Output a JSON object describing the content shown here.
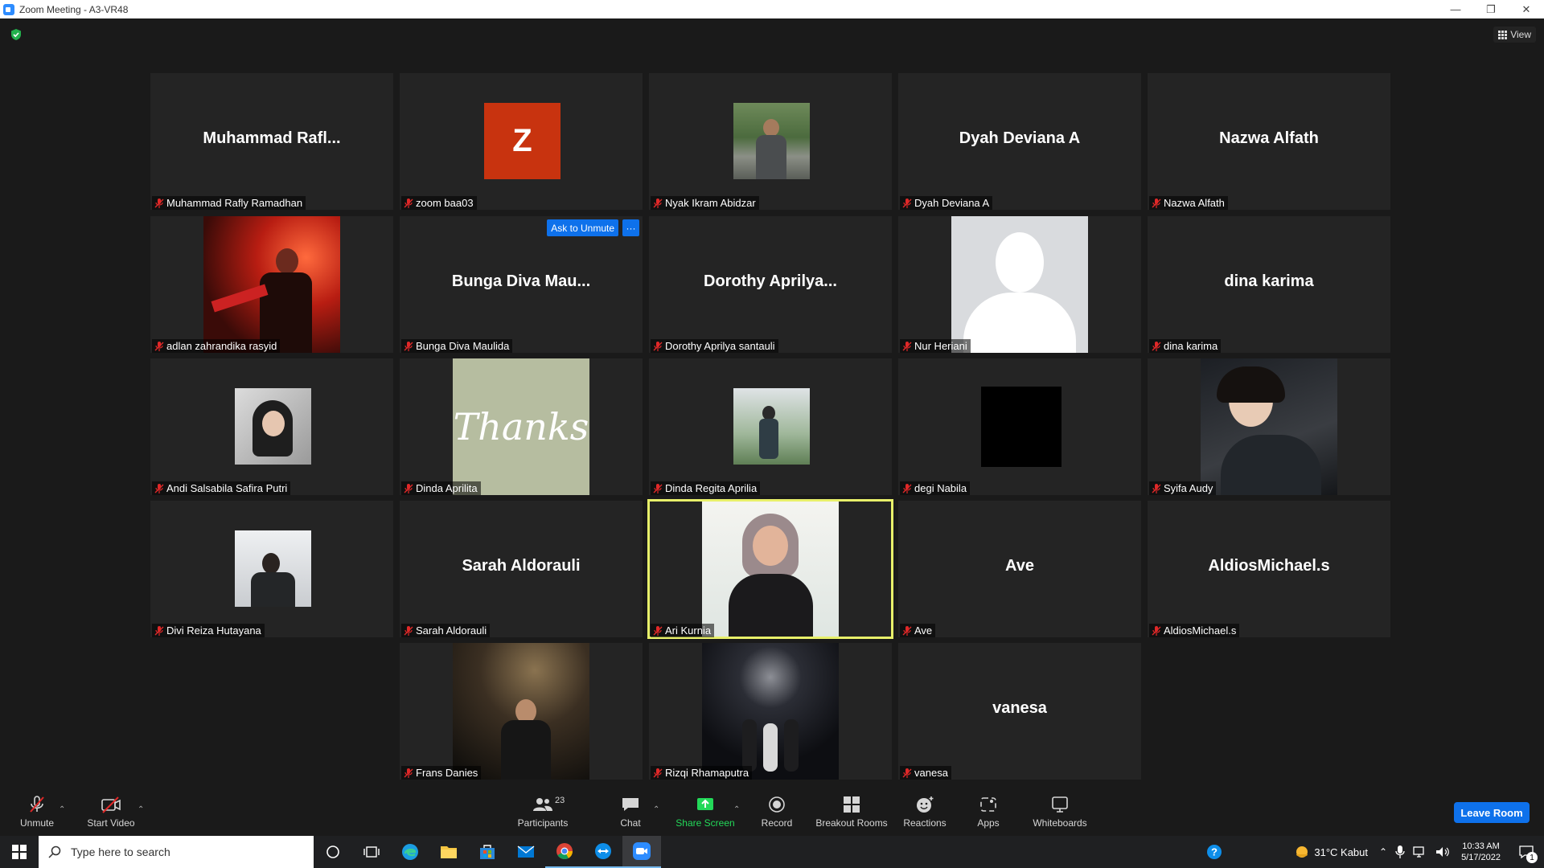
{
  "window": {
    "title": "Zoom Meeting - A3-VR48"
  },
  "view_button": "View",
  "tiles": [
    {
      "name": "Muhammad Rafly Ramadhan",
      "display": "Muhammad  Rafl..."
    },
    {
      "name": "zoom baa03",
      "avatar_letter": "Z"
    },
    {
      "name": "Nyak Ikram Abidzar"
    },
    {
      "name": "Dyah Deviana A",
      "display": "Dyah Deviana A"
    },
    {
      "name": "Nazwa Alfath",
      "display": "Nazwa Alfath"
    },
    {
      "name": "adlan zahrandika rasyid"
    },
    {
      "name": "Bunga Diva Maulida",
      "display": "Bunga  Diva  Mau...",
      "hover_action": "Ask to Unmute",
      "more_label": "···"
    },
    {
      "name": "Dorothy Aprilya santauli",
      "display": "Dorothy  Aprilya..."
    },
    {
      "name": "Nur Heriani"
    },
    {
      "name": "dina karima",
      "display": "dina karima"
    },
    {
      "name": "Andi Salsabila Safira Putri"
    },
    {
      "name": "Dinda Aprilita",
      "photo_text": "Thanks"
    },
    {
      "name": "Dinda Regita Aprilia"
    },
    {
      "name": "degi Nabila"
    },
    {
      "name": "Syifa Audy"
    },
    {
      "name": "Divi Reiza Hutayana"
    },
    {
      "name": "Sarah Aldorauli",
      "display": "Sarah Aldorauli"
    },
    {
      "name": "Ari Kurnia"
    },
    {
      "name": "Ave",
      "display": "Ave"
    },
    {
      "name": "AldiosMichael.s",
      "display": "AldiosMichael.s"
    },
    {
      "name": "Frans Danies"
    },
    {
      "name": "Rizqi Rhamaputra"
    },
    {
      "name": "vanesa",
      "display": "vanesa"
    }
  ],
  "toolbar": {
    "unmute": "Unmute",
    "start_video": "Start Video",
    "participants": "Participants",
    "participants_count": "23",
    "chat": "Chat",
    "share_screen": "Share Screen",
    "record": "Record",
    "breakout_rooms": "Breakout Rooms",
    "reactions": "Reactions",
    "apps": "Apps",
    "whiteboards": "Whiteboards",
    "leave_room": "Leave Room"
  },
  "taskbar": {
    "search_placeholder": "Type here to search",
    "weather": "31°C  Kabut",
    "time": "10:33 AM",
    "date": "5/17/2022",
    "notification_count": "1"
  },
  "colors": {
    "accent": "#0e71eb",
    "active_speaker": "#e8f06a",
    "muted": "#e02828",
    "share_green": "#23d959"
  }
}
